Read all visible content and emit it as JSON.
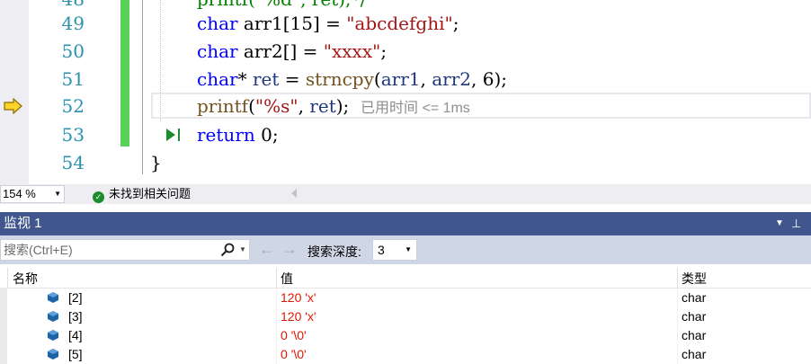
{
  "editor": {
    "partial_top_line": "printf(\"%d\", ret);*/",
    "lines": [
      {
        "num": "49"
      },
      {
        "num": "50"
      },
      {
        "num": "51"
      },
      {
        "num": "52"
      },
      {
        "num": "53"
      },
      {
        "num": "54"
      }
    ],
    "code49": {
      "kw": "char",
      "a": " arr1[15] = ",
      "s": "\"abcdefghi\"",
      "b": ";"
    },
    "code50": {
      "kw": "char",
      "a": " arr2[] = ",
      "s": "\"xxxx\"",
      "b": ";"
    },
    "code51": {
      "kw": "char",
      "a": "* ",
      "id": "ret",
      "b": " = ",
      "fn": "strncpy",
      "c": "(",
      "id2": "arr1",
      "d": ", ",
      "id3": "arr2",
      "e": ", 6);"
    },
    "code52": {
      "fn": "printf",
      "a": "(",
      "s": "\"%s\"",
      "b": ", ",
      "id": "ret",
      "c": ");",
      "elapsed": "已用时间 <= 1ms"
    },
    "code53": {
      "kw": "return",
      "a": " 0;"
    },
    "code54": {
      "a": "}"
    }
  },
  "status_bar": {
    "zoom": "154 %",
    "issues": "未找到相关问题"
  },
  "watch": {
    "title": "监视 1",
    "search_placeholder": "搜索(Ctrl+E)",
    "depth_label": "搜索深度:",
    "depth_value": "3",
    "columns": {
      "name": "名称",
      "value": "值",
      "type": "类型"
    },
    "rows": [
      {
        "name": "[2]",
        "value": "120 'x'",
        "type": "char"
      },
      {
        "name": "[3]",
        "value": "120 'x'",
        "type": "char"
      },
      {
        "name": "[4]",
        "value": "0 '\\0'",
        "type": "char"
      },
      {
        "name": "[5]",
        "value": "0 '\\0'",
        "type": "char"
      }
    ]
  },
  "colors": {
    "keyword": "#0000ff",
    "string": "#a31515",
    "line_number": "#2b91af",
    "change_bar": "#57d158",
    "panel_title_bg": "#40568d",
    "watch_value": "#e51400"
  }
}
